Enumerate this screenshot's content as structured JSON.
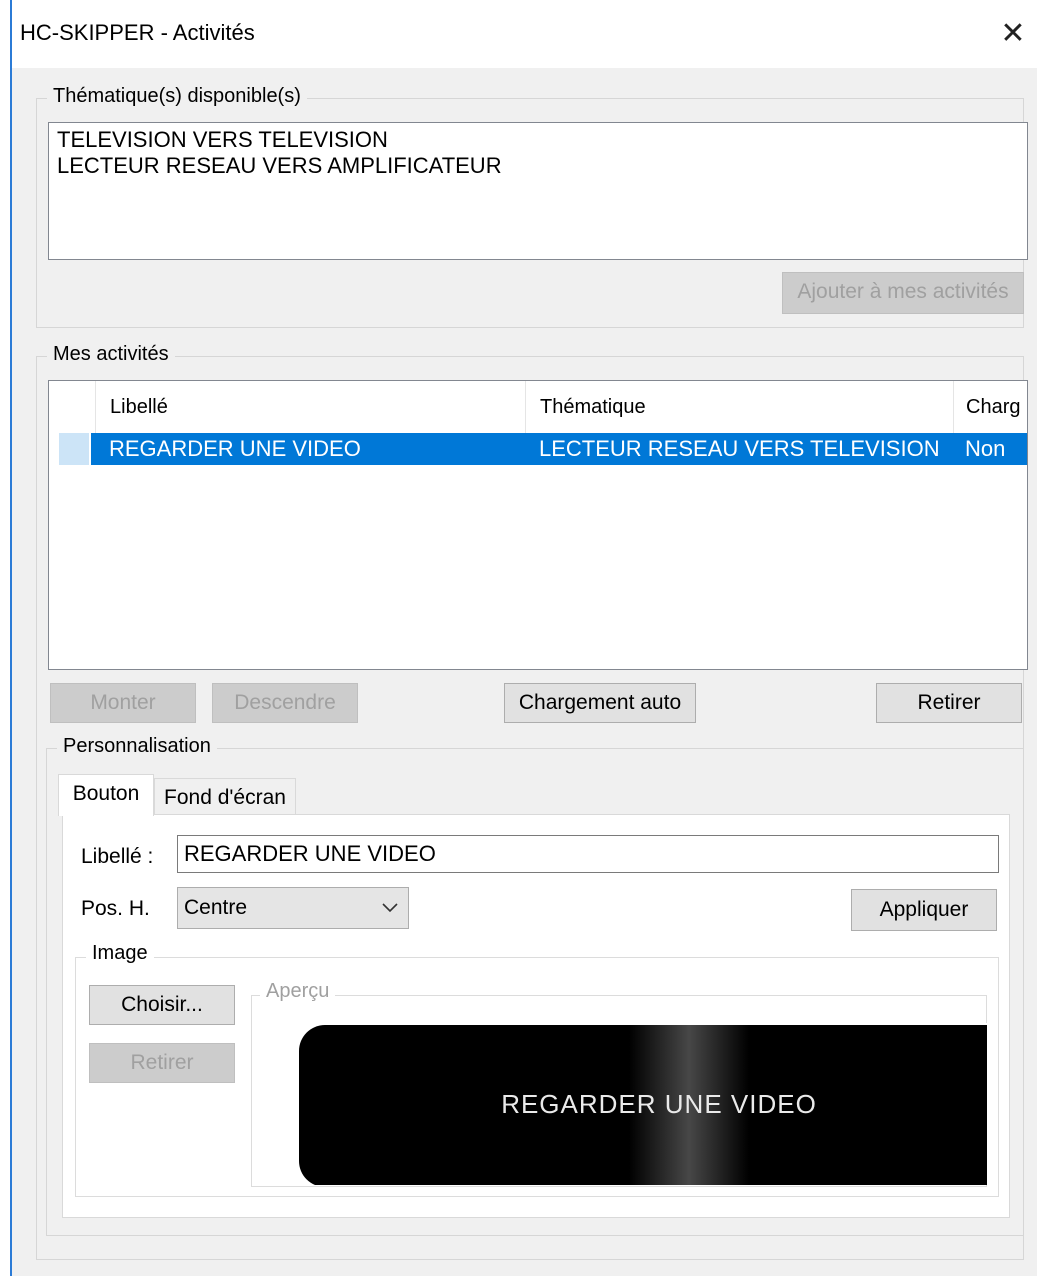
{
  "window": {
    "title": "HC-SKIPPER - Activités",
    "close_symbol": "✕"
  },
  "available": {
    "label": "Thématique(s) disponible(s)",
    "items": [
      "TELEVISION VERS TELEVISION",
      "LECTEUR RESEAU VERS AMPLIFICATEUR"
    ],
    "add_button": "Ajouter à mes activités"
  },
  "mine": {
    "label": "Mes activités",
    "columns": [
      "Libellé",
      "Thématique",
      "Charg"
    ],
    "rows": [
      {
        "libelle": "REGARDER UNE VIDEO",
        "thematique": "LECTEUR RESEAU VERS TELEVISION",
        "charg": "Non"
      }
    ],
    "buttons": {
      "up": "Monter",
      "down": "Descendre",
      "auto": "Chargement auto",
      "remove": "Retirer"
    }
  },
  "perso": {
    "label": "Personnalisation",
    "tabs": [
      "Bouton",
      "Fond d'écran"
    ],
    "libelle_label": "Libellé :",
    "libelle_value": "REGARDER UNE VIDEO",
    "posh_label": "Pos. H.",
    "posh_value": "Centre",
    "apply": "Appliquer",
    "image": {
      "label": "Image",
      "choose": "Choisir...",
      "remove": "Retirer",
      "preview_label": "Aperçu",
      "preview_text": "REGARDER UNE VIDEO"
    }
  },
  "icons": {
    "close": "close-icon",
    "dropdown": "chevron-down-icon"
  }
}
